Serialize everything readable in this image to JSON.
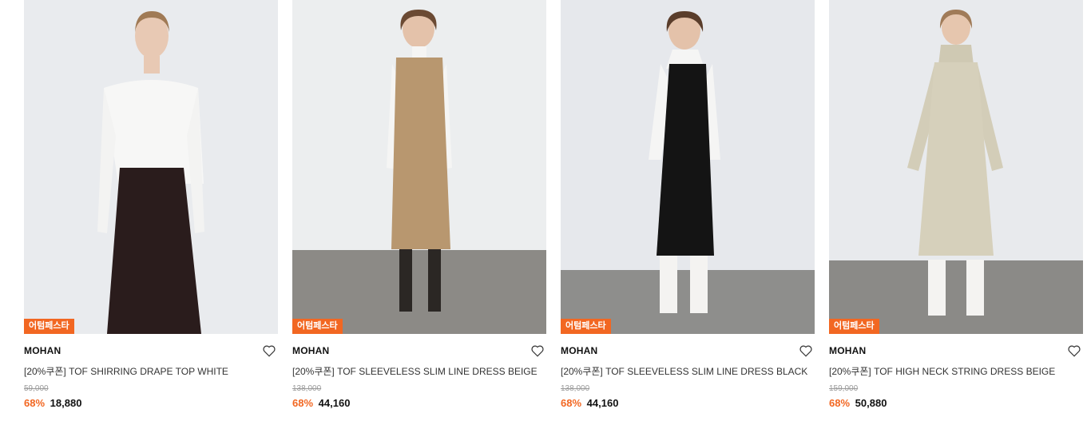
{
  "colors": {
    "accent": "#f26722"
  },
  "products": [
    {
      "badge": "어텀페스타",
      "brand": "MOHAN",
      "name": "[20%쿠폰] TOF SHIRRING DRAPE TOP WHITE",
      "original_price": "59,000",
      "discount": "68%",
      "price": "18,880",
      "wishlist_icon": "heart-outline-icon"
    },
    {
      "badge": "어텀페스타",
      "brand": "MOHAN",
      "name": "[20%쿠폰] TOF SLEEVELESS SLIM LINE DRESS BEIGE",
      "original_price": "138,000",
      "discount": "68%",
      "price": "44,160",
      "wishlist_icon": "heart-outline-icon"
    },
    {
      "badge": "어텀페스타",
      "brand": "MOHAN",
      "name": "[20%쿠폰] TOF SLEEVELESS SLIM LINE DRESS BLACK",
      "original_price": "138,000",
      "discount": "68%",
      "price": "44,160",
      "wishlist_icon": "heart-outline-icon"
    },
    {
      "badge": "어텀페스타",
      "brand": "MOHAN",
      "name": "[20%쿠폰] TOF HIGH NECK STRING DRESS BEIGE",
      "original_price": "159,000",
      "discount": "68%",
      "price": "50,880",
      "wishlist_icon": "heart-outline-icon"
    }
  ]
}
